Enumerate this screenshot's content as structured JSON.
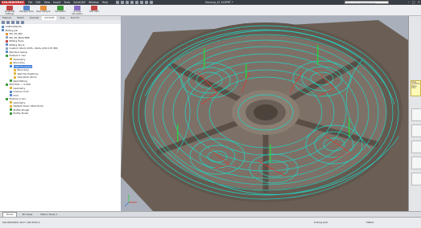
{
  "app": {
    "logo": "SOLIDWORKS",
    "menu": [
      "File",
      "Edit",
      "View",
      "Insert",
      "Tools",
      "SolidCAM",
      "Window",
      "Help"
    ],
    "title": "Housing_A1.SLDPRT *",
    "search_placeholder": "Search SOLIDWORKS Help"
  },
  "ribbon": {
    "buttons": [
      {
        "label": "SolidCAM Settings",
        "icon": "settings-icon"
      },
      {
        "label": "Manage Tools",
        "icon": "tools-icon"
      },
      {
        "label": "New CAM Job",
        "icon": "new-job-icon"
      },
      {
        "label": "Simulation",
        "icon": "simulation-icon"
      },
      {
        "label": "G-Code Simulation",
        "icon": "gcode-icon"
      },
      {
        "label": "Exit CAM",
        "icon": "exit-icon"
      }
    ]
  },
  "panel_tabs": [
    "Features",
    "Sketch",
    "Evaluate",
    "SolidCAM",
    "Scan",
    "Part Info"
  ],
  "tree": [
    {
      "label": "CAM-Defaults",
      "indent": 0,
      "color": "#5b87c9"
    },
    {
      "label": "Milling Job",
      "indent": 0,
      "color": "#5b87c9"
    },
    {
      "label": "MC_Fit_Mill",
      "indent": 1,
      "color": "#e6903a"
    },
    {
      "label": "MC_Fit_MACHINE",
      "indent": 1,
      "color": "#8aa0bc"
    },
    {
      "label": "Milling Tools",
      "indent": 1,
      "color": "#c24343"
    },
    {
      "label": "Milling Stock",
      "indent": 1,
      "color": "#5b87c9"
    },
    {
      "label": "Custom Stock (DVS...Parts (203-137-88)",
      "indent": 1,
      "color": "#8aa0bc"
    },
    {
      "label": "Machine Setup",
      "indent": 1,
      "color": "#5b87c9"
    },
    {
      "label": "Feature 1 Lev.",
      "indent": 1,
      "color": "#3b9a3b"
    },
    {
      "label": "Geometry",
      "indent": 2,
      "color": "#e0b43a"
    },
    {
      "label": "Boundary",
      "indent": 2,
      "color": "#e0b43a"
    },
    {
      "label": "HSM Roughing",
      "indent": 2,
      "color": "#3d7ddb",
      "selected": true
    },
    {
      "label": "Boundary",
      "indent": 3,
      "color": "#e0b43a"
    },
    {
      "label": "Wall Tip Positions",
      "indent": 3,
      "color": "#e0b43a"
    },
    {
      "label": "Operation Stock",
      "indent": 3,
      "color": "#e0b43a"
    },
    {
      "label": "Rest Milling",
      "indent": 2,
      "color": "#3b9a3b"
    },
    {
      "label": "Mill Hole — 5.000",
      "indent": 1,
      "color": "#3b9a3b"
    },
    {
      "label": "Geometry",
      "indent": 2,
      "color": "#e0b43a"
    },
    {
      "label": "Contour Drill",
      "indent": 2,
      "color": "#5b87c9"
    },
    {
      "label": "Drill",
      "indent": 2,
      "color": "#5b87c9"
    },
    {
      "label": "Feature 2 Lev.",
      "indent": 1,
      "color": "#3b9a3b"
    },
    {
      "label": "Geometry",
      "indent": 2,
      "color": "#e0b43a"
    },
    {
      "label": "Default Chain Start Point",
      "indent": 2,
      "color": "#e0b43a"
    },
    {
      "label": "Profile Rough",
      "indent": 2,
      "color": "#3b9a3b"
    },
    {
      "label": "Profile Finish",
      "indent": 2,
      "color": "#3b9a3b"
    }
  ],
  "viewport": {
    "name": "3D toolpath viewport",
    "toolpath_color": "#1fd6c7",
    "rapid_color": "#d93a2e",
    "part_color": "#6f6358"
  },
  "right_panel": {
    "tip": "Drag and drop items here"
  },
  "bottom_tabs": [
    "Model",
    "3D Views",
    "Motion Study 1"
  ],
  "status": {
    "left": "SOLIDWORKS 2017 x64 Edition",
    "mid": "Editing Part",
    "right": "MMGS"
  }
}
